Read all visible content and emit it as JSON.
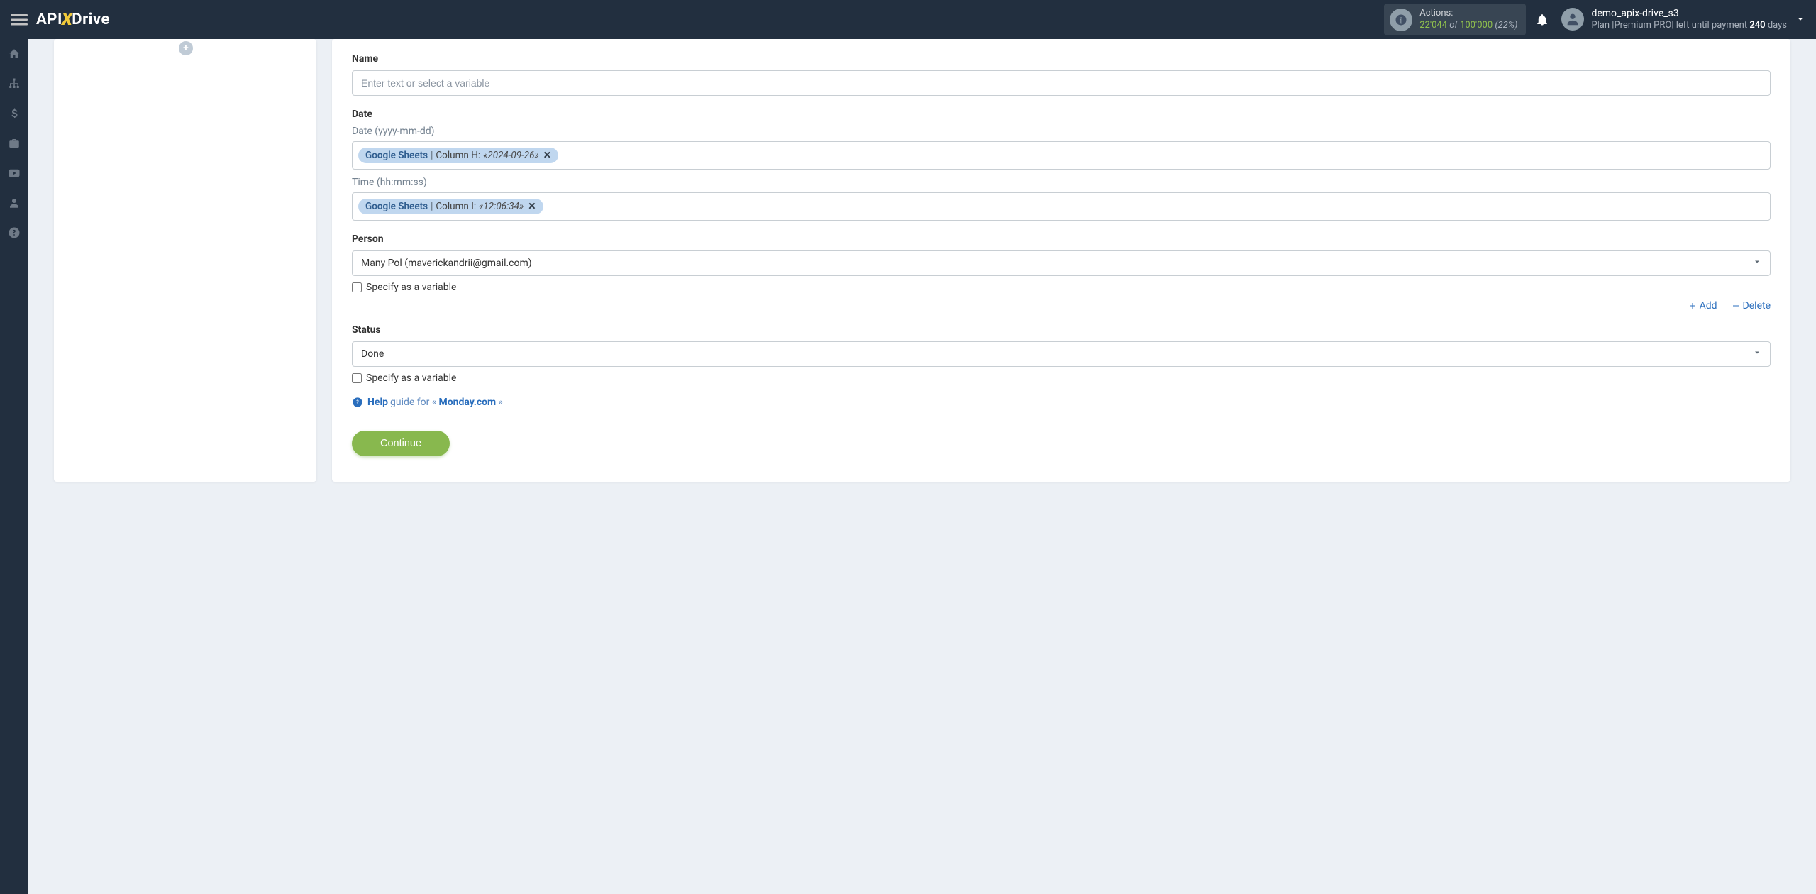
{
  "header": {
    "logo_pre": "API",
    "logo_x": "X",
    "logo_post": "Drive",
    "actions_label": "Actions:",
    "actions_current": "22'044",
    "actions_of": " of ",
    "actions_total": "100'000",
    "actions_pct": " (22%)",
    "username": "demo_apix-drive_s3",
    "plan_prefix": "Plan  |Premium PRO|  left until payment ",
    "plan_days": "240",
    "plan_suffix": " days"
  },
  "form": {
    "name_label": "Name",
    "name_placeholder": "Enter text or select a variable",
    "date_label": "Date",
    "date_sublabel": "Date (yyyy-mm-dd)",
    "date_chip_source": "Google Sheets",
    "date_chip_col": "Column H:",
    "date_chip_example": "«2024-09-26»",
    "time_sublabel": "Time (hh:mm:ss)",
    "time_chip_source": "Google Sheets",
    "time_chip_col": "Column I:",
    "time_chip_example": "«12:06:34»",
    "person_label": "Person",
    "person_value": "Many Pol (maverickandrii@gmail.com)",
    "specify_variable": "Specify as a variable",
    "add_label": "Add",
    "delete_label": "Delete",
    "status_label": "Status",
    "status_value": "Done",
    "help_bold": "Help",
    "help_mid": " guide for «",
    "help_target": "Monday.com",
    "help_end": "»",
    "continue": "Continue"
  }
}
